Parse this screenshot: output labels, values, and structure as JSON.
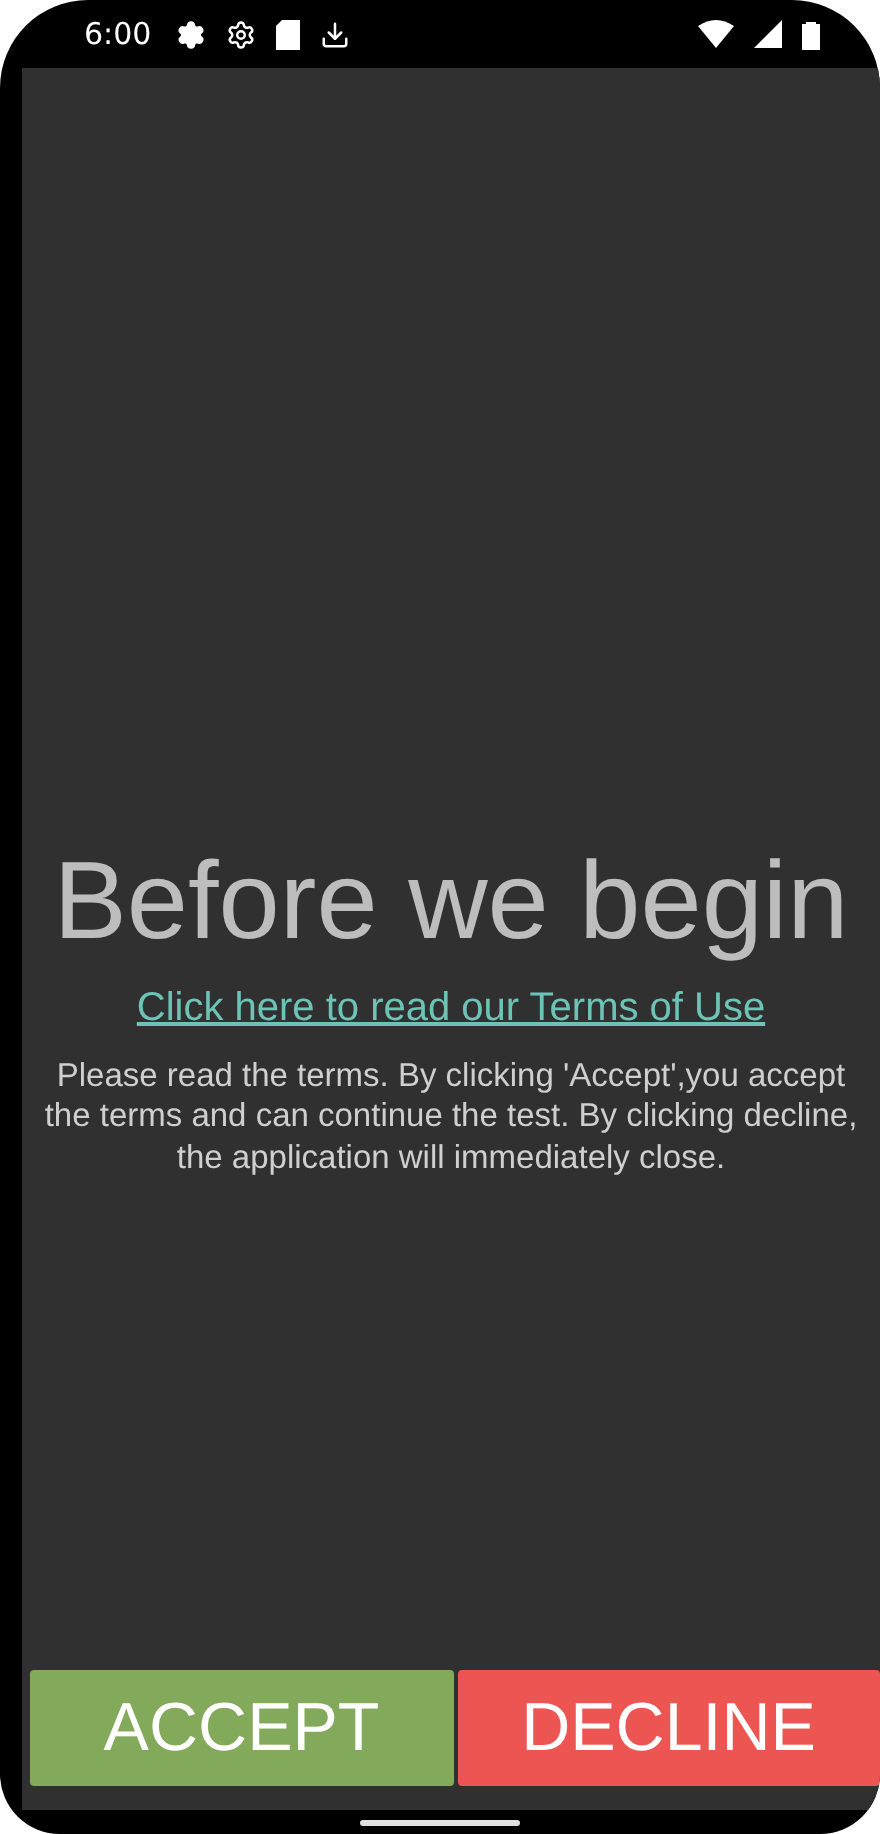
{
  "status_bar": {
    "time": "6:00"
  },
  "title": "Before we begin",
  "terms_link": "Click here to read our Terms of Use",
  "message": "Please read the terms. By clicking 'Accept',you accept the terms and can continue the test. By clicking decline, the application will immediately close.",
  "buttons": [
    {
      "label": "ACCEPT",
      "kind": "accept"
    },
    {
      "label": "DECLINE",
      "kind": "decline"
    }
  ]
}
